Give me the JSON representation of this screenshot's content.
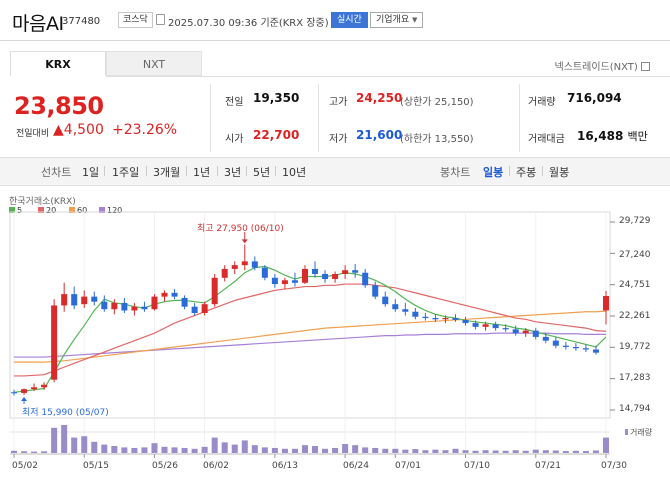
{
  "header": {
    "name": "마음AI",
    "code": "377480",
    "market_badge": "코스닥",
    "datetime": "2025.07.30 09:36",
    "basis": "기준(KRX 장중)",
    "realtime_label": "실시간",
    "company_info_label": "기업개요"
  },
  "tabs": [
    {
      "label": "KRX",
      "active": true
    },
    {
      "label": "NXT",
      "active": false
    }
  ],
  "nextrade_link": "넥스트레이드(NXT)",
  "price": {
    "current": "23,850",
    "change_label": "전일대비",
    "change_arrow": "▲",
    "change_value": "4,500",
    "change_pct": "+23.26%"
  },
  "stats": {
    "prev_close": {
      "label": "전일",
      "value": "19,350"
    },
    "open": {
      "label": "시가",
      "value": "22,700"
    },
    "high": {
      "label": "고가",
      "value": "24,250",
      "extra": "(상한가 25,150)"
    },
    "low": {
      "label": "저가",
      "value": "21,600",
      "extra": "(하한가 13,550)"
    },
    "volume": {
      "label": "거래량",
      "value": "716,094"
    },
    "amount": {
      "label": "거래대금",
      "value": "16,488",
      "unit": "백만"
    }
  },
  "toolbar": {
    "line_chart": "선차트",
    "periods": [
      "1일",
      "1주일",
      "3개월",
      "1년",
      "3년",
      "5년",
      "10년"
    ],
    "candle_label": "봉차트",
    "candle_periods": [
      {
        "label": "일봉",
        "active": true
      },
      {
        "label": "주봉",
        "active": false
      },
      {
        "label": "월봉",
        "active": false
      }
    ]
  },
  "colors": {
    "up": "#d92b2b",
    "down": "#2b6bd9",
    "ma5": "#52b552",
    "ma20": "#e06666",
    "ma60": "#f0a050",
    "ma120": "#a880d8",
    "volume": "#9a8cc8"
  },
  "chart_data": {
    "type": "candlestick",
    "source": "한국거래소(KRX)",
    "legend": [
      {
        "name": "5",
        "color": "#52b552"
      },
      {
        "name": "20",
        "color": "#e06666"
      },
      {
        "name": "60",
        "color": "#f0a050"
      },
      {
        "name": "120",
        "color": "#a880d8"
      }
    ],
    "y_ticks": [
      "29,729",
      "27,240",
      "24,751",
      "22,261",
      "19,772",
      "17,283",
      "14,794"
    ],
    "y_range": [
      14794,
      29729
    ],
    "x_ticks": [
      "05/02",
      "05/15",
      "05/26",
      "06/02",
      "06/13",
      "06/24",
      "07/01",
      "07/10",
      "07/21",
      "07/30"
    ],
    "high_annotation": "최고 27,950 (06/10)",
    "low_annotation": "최저 15,990 (05/07)",
    "volume_label": "거래량",
    "candles": [
      {
        "d": "05/02",
        "o": 16200,
        "h": 16400,
        "l": 15950,
        "c": 16150
      },
      {
        "d": "05/07",
        "o": 16150,
        "h": 16500,
        "l": 15990,
        "c": 16450
      },
      {
        "d": "05/08",
        "o": 16450,
        "h": 16900,
        "l": 16300,
        "c": 16600
      },
      {
        "d": "05/09",
        "o": 16600,
        "h": 17000,
        "l": 16400,
        "c": 16800
      },
      {
        "d": "05/12",
        "o": 17200,
        "h": 23600,
        "l": 17000,
        "c": 23100
      },
      {
        "d": "05/13",
        "o": 23100,
        "h": 24900,
        "l": 22600,
        "c": 24000
      },
      {
        "d": "05/14",
        "o": 24000,
        "h": 24600,
        "l": 22800,
        "c": 23100
      },
      {
        "d": "05/15",
        "o": 23200,
        "h": 24300,
        "l": 22900,
        "c": 23800
      },
      {
        "d": "05/16",
        "o": 23800,
        "h": 24200,
        "l": 23100,
        "c": 23400
      },
      {
        "d": "05/19",
        "o": 23400,
        "h": 23900,
        "l": 22600,
        "c": 22800
      },
      {
        "d": "05/20",
        "o": 22800,
        "h": 23600,
        "l": 22400,
        "c": 23300
      },
      {
        "d": "05/21",
        "o": 23300,
        "h": 23700,
        "l": 22500,
        "c": 22700
      },
      {
        "d": "05/22",
        "o": 22700,
        "h": 23300,
        "l": 22300,
        "c": 23000
      },
      {
        "d": "05/23",
        "o": 23000,
        "h": 23400,
        "l": 22600,
        "c": 22800
      },
      {
        "d": "05/26",
        "o": 22800,
        "h": 24000,
        "l": 22700,
        "c": 23800
      },
      {
        "d": "05/27",
        "o": 23800,
        "h": 24300,
        "l": 23400,
        "c": 24100
      },
      {
        "d": "05/28",
        "o": 24100,
        "h": 24400,
        "l": 23600,
        "c": 23800
      },
      {
        "d": "05/29",
        "o": 23700,
        "h": 23900,
        "l": 22800,
        "c": 23000
      },
      {
        "d": "05/30",
        "o": 23000,
        "h": 23300,
        "l": 22300,
        "c": 22500
      },
      {
        "d": "06/02",
        "o": 22500,
        "h": 23400,
        "l": 22300,
        "c": 23200
      },
      {
        "d": "06/04",
        "o": 23200,
        "h": 25600,
        "l": 23000,
        "c": 25300
      },
      {
        "d": "06/05",
        "o": 25300,
        "h": 26300,
        "l": 25000,
        "c": 26000
      },
      {
        "d": "06/09",
        "o": 26000,
        "h": 26600,
        "l": 25600,
        "c": 26300
      },
      {
        "d": "06/10",
        "o": 26300,
        "h": 27950,
        "l": 25900,
        "c": 26600
      },
      {
        "d": "06/11",
        "o": 26600,
        "h": 27000,
        "l": 25900,
        "c": 26100
      },
      {
        "d": "06/12",
        "o": 26100,
        "h": 26300,
        "l": 25100,
        "c": 25300
      },
      {
        "d": "06/13",
        "o": 25300,
        "h": 25600,
        "l": 24500,
        "c": 24800
      },
      {
        "d": "06/16",
        "o": 24800,
        "h": 25300,
        "l": 24400,
        "c": 25100
      },
      {
        "d": "06/17",
        "o": 25100,
        "h": 25700,
        "l": 24600,
        "c": 24900
      },
      {
        "d": "06/18",
        "o": 24900,
        "h": 26300,
        "l": 24800,
        "c": 26000
      },
      {
        "d": "06/19",
        "o": 26000,
        "h": 26600,
        "l": 25300,
        "c": 25600
      },
      {
        "d": "06/20",
        "o": 25600,
        "h": 25900,
        "l": 24900,
        "c": 25200
      },
      {
        "d": "06/23",
        "o": 25200,
        "h": 25800,
        "l": 24900,
        "c": 25600
      },
      {
        "d": "06/24",
        "o": 25600,
        "h": 26300,
        "l": 25200,
        "c": 25900
      },
      {
        "d": "06/25",
        "o": 25900,
        "h": 26400,
        "l": 25300,
        "c": 25700
      },
      {
        "d": "06/26",
        "o": 25700,
        "h": 26000,
        "l": 24500,
        "c": 24700
      },
      {
        "d": "06/27",
        "o": 24700,
        "h": 25000,
        "l": 23600,
        "c": 23800
      },
      {
        "d": "06/30",
        "o": 23800,
        "h": 24200,
        "l": 23000,
        "c": 23200
      },
      {
        "d": "07/01",
        "o": 23200,
        "h": 23600,
        "l": 22600,
        "c": 22800
      },
      {
        "d": "07/02",
        "o": 22800,
        "h": 23300,
        "l": 22300,
        "c": 22600
      },
      {
        "d": "07/03",
        "o": 22600,
        "h": 22900,
        "l": 22000,
        "c": 22200
      },
      {
        "d": "07/04",
        "o": 22200,
        "h": 22500,
        "l": 21900,
        "c": 22100
      },
      {
        "d": "07/07",
        "o": 22100,
        "h": 22400,
        "l": 21800,
        "c": 22000
      },
      {
        "d": "07/08",
        "o": 22000,
        "h": 22300,
        "l": 21700,
        "c": 22100
      },
      {
        "d": "07/09",
        "o": 22100,
        "h": 22400,
        "l": 21800,
        "c": 21950
      },
      {
        "d": "07/10",
        "o": 21950,
        "h": 22200,
        "l": 21500,
        "c": 21700
      },
      {
        "d": "07/11",
        "o": 21700,
        "h": 21900,
        "l": 21200,
        "c": 21400
      },
      {
        "d": "07/14",
        "o": 21400,
        "h": 21800,
        "l": 21100,
        "c": 21600
      },
      {
        "d": "07/15",
        "o": 21600,
        "h": 21800,
        "l": 21100,
        "c": 21300
      },
      {
        "d": "07/16",
        "o": 21300,
        "h": 21600,
        "l": 21000,
        "c": 21200
      },
      {
        "d": "07/17",
        "o": 21200,
        "h": 21500,
        "l": 20700,
        "c": 20900
      },
      {
        "d": "07/18",
        "o": 20900,
        "h": 21300,
        "l": 20600,
        "c": 21100
      },
      {
        "d": "07/21",
        "o": 21100,
        "h": 21300,
        "l": 20400,
        "c": 20600
      },
      {
        "d": "07/22",
        "o": 20600,
        "h": 20900,
        "l": 20100,
        "c": 20300
      },
      {
        "d": "07/23",
        "o": 20300,
        "h": 20600,
        "l": 19700,
        "c": 19900
      },
      {
        "d": "07/24",
        "o": 19900,
        "h": 20200,
        "l": 19600,
        "c": 19800
      },
      {
        "d": "07/25",
        "o": 19800,
        "h": 20100,
        "l": 19500,
        "c": 19700
      },
      {
        "d": "07/28",
        "o": 19700,
        "h": 20000,
        "l": 19400,
        "c": 19600
      },
      {
        "d": "07/29",
        "o": 19600,
        "h": 19900,
        "l": 19200,
        "c": 19350
      },
      {
        "d": "07/30",
        "o": 22700,
        "h": 24250,
        "l": 21600,
        "c": 23850
      }
    ],
    "volume": [
      8,
      6,
      5,
      6,
      90,
      100,
      55,
      60,
      40,
      30,
      25,
      20,
      18,
      20,
      35,
      22,
      20,
      18,
      15,
      22,
      55,
      38,
      30,
      45,
      28,
      20,
      18,
      15,
      15,
      28,
      25,
      15,
      18,
      32,
      28,
      20,
      18,
      15,
      15,
      12,
      14,
      10,
      12,
      10,
      15,
      10,
      8,
      10,
      9,
      8,
      10,
      8,
      12,
      10,
      9,
      7,
      8,
      7,
      9,
      55
    ],
    "ma5": [
      16200,
      16300,
      16400,
      16500,
      17800,
      19200,
      20400,
      21500,
      22700,
      23600,
      23300,
      23200,
      23000,
      22900,
      23200,
      23400,
      23500,
      23500,
      23400,
      23300,
      23800,
      24400,
      25000,
      25700,
      26100,
      26200,
      25900,
      25500,
      25200,
      25400,
      25400,
      25400,
      25500,
      25700,
      25600,
      25400,
      25100,
      24700,
      24200,
      23600,
      23100,
      22700,
      22400,
      22200,
      22100,
      21900,
      21800,
      21700,
      21600,
      21500,
      21300,
      21200,
      21000,
      20800,
      20600,
      20400,
      20200,
      20000,
      19800,
      20600
    ],
    "ma20": [
      17500,
      17500,
      17550,
      17600,
      17900,
      18200,
      18500,
      18800,
      19100,
      19400,
      19700,
      20000,
      20300,
      20600,
      20900,
      21300,
      21700,
      22000,
      22300,
      22600,
      22900,
      23200,
      23500,
      23700,
      23900,
      24100,
      24300,
      24400,
      24500,
      24600,
      24600,
      24700,
      24700,
      24800,
      24800,
      24800,
      24700,
      24600,
      24500,
      24300,
      24100,
      23900,
      23700,
      23500,
      23300,
      23100,
      22900,
      22700,
      22500,
      22300,
      22100,
      22000,
      21800,
      21700,
      21600,
      21500,
      21400,
      21300,
      21100,
      21050
    ],
    "ma60": [
      18600,
      18600,
      18600,
      18600,
      18650,
      18700,
      18800,
      18900,
      19000,
      19100,
      19200,
      19300,
      19400,
      19500,
      19600,
      19700,
      19800,
      19900,
      20000,
      20100,
      20200,
      20300,
      20400,
      20500,
      20600,
      20700,
      20800,
      20900,
      21000,
      21100,
      21200,
      21300,
      21350,
      21400,
      21450,
      21500,
      21550,
      21600,
      21650,
      21700,
      21750,
      21800,
      21850,
      21900,
      21950,
      22000,
      22050,
      22100,
      22150,
      22200,
      22250,
      22300,
      22350,
      22400,
      22450,
      22500,
      22550,
      22600,
      22600,
      22650
    ],
    "ma120": [
      19000,
      19000,
      19000,
      19000,
      19050,
      19100,
      19150,
      19200,
      19250,
      19300,
      19350,
      19400,
      19450,
      19500,
      19550,
      19600,
      19650,
      19700,
      19750,
      19800,
      19850,
      19900,
      19950,
      20000,
      20050,
      20100,
      20150,
      20200,
      20250,
      20300,
      20350,
      20400,
      20450,
      20500,
      20550,
      20600,
      20650,
      20700,
      20700,
      20750,
      20750,
      20800,
      20800,
      20800,
      20850,
      20850,
      20850,
      20850,
      20900,
      20900,
      20900,
      20900,
      20900,
      20900,
      20850,
      20850,
      20850,
      20800,
      20800,
      20800
    ]
  }
}
